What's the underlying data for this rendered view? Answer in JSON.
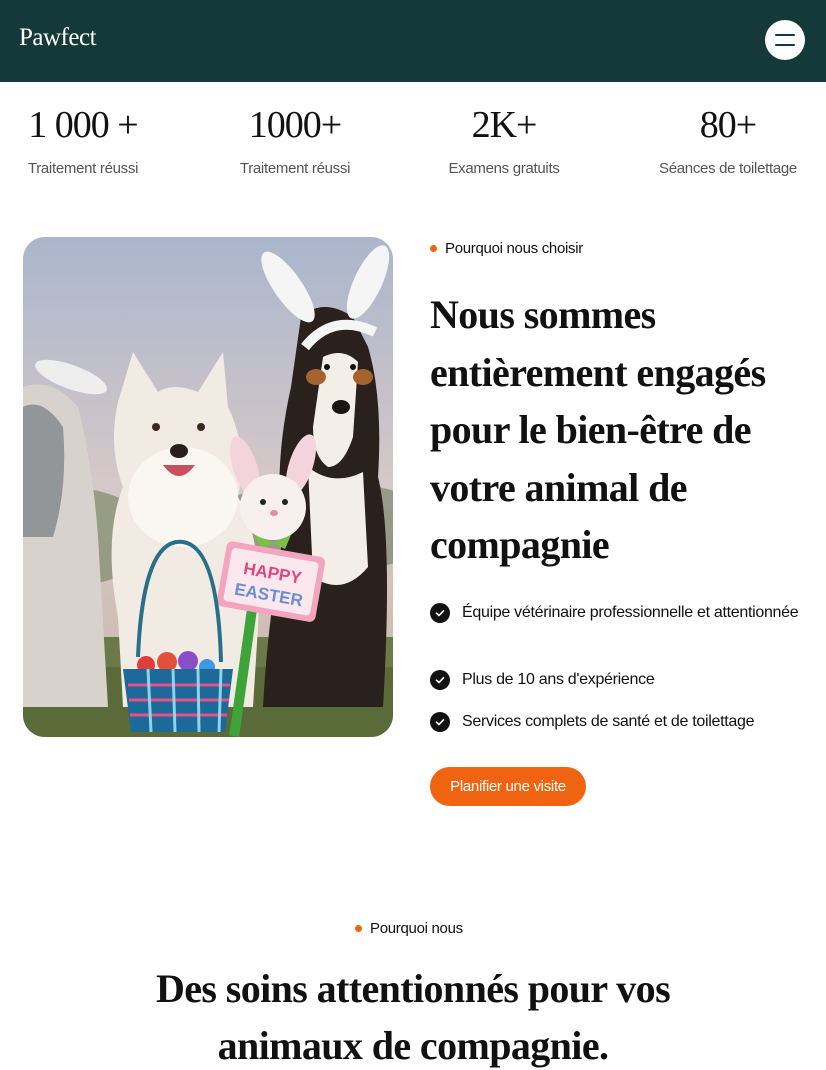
{
  "header": {
    "logo": "Pawfect",
    "menu_icon": "hamburger-menu-icon",
    "background": "#133a38"
  },
  "stats": [
    {
      "value": "1 000 +",
      "label": "Traitement réussi"
    },
    {
      "value": "1000+",
      "label": "Traitement réussi"
    },
    {
      "value": "2K+",
      "label": "Examens gratuits"
    },
    {
      "value": "80+",
      "label": "Séances de toilettage"
    }
  ],
  "about": {
    "eyebrow": "Pourquoi nous choisir",
    "headline": "Nous sommes entièrement engagés pour le bien-être de votre animal de compagnie",
    "features": [
      "Équipe vétérinaire professionnelle et attentionnée",
      "Plus de 10 ans d'expérience",
      "Services complets de santé et de toilettage"
    ],
    "feature_icon": "check-circle-icon",
    "cta_label": "Planifier une visite",
    "sign_text_line1": "HAPPY",
    "sign_text_line2": "EASTER"
  },
  "why_us": {
    "eyebrow": "Pourquoi nous",
    "headline": "Des soins attentionnés pour vos animaux de compagnie."
  },
  "colors": {
    "accent": "#f06411",
    "brand_dark": "#133a38"
  }
}
